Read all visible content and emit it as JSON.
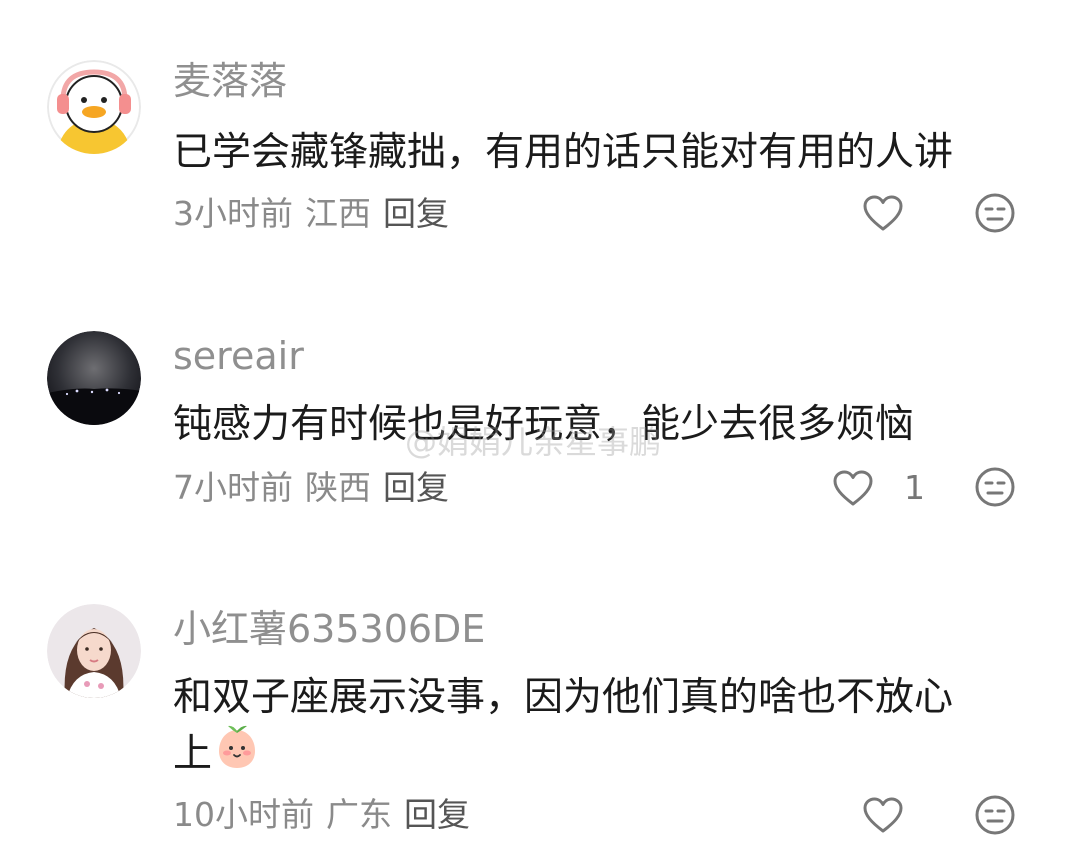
{
  "comments": [
    {
      "username": "麦落落",
      "text": "已学会藏锋藏拙，有用的话只能对有用的人讲",
      "time": "3小时前",
      "location": "江西",
      "reply_label": "回复",
      "like_count": ""
    },
    {
      "username": "sereair",
      "text": "钝感力有时候也是好玩意，能少去很多烦恼",
      "time": "7小时前",
      "location": "陕西",
      "reply_label": "回复",
      "like_count": "1"
    },
    {
      "username": "小红薯635306DE",
      "text_line1": "和双子座展示没事，因为他们真的啥也不放心",
      "text_line2": "上",
      "time": "10小时前",
      "location": "广东",
      "reply_label": "回复",
      "like_count": ""
    }
  ],
  "watermark": "@娟娟儿亲星事鹏",
  "icons": {
    "like": "heart-outline-icon",
    "dislike": "neutral-face-icon",
    "inline_emoji": "peach-face-emoji"
  }
}
